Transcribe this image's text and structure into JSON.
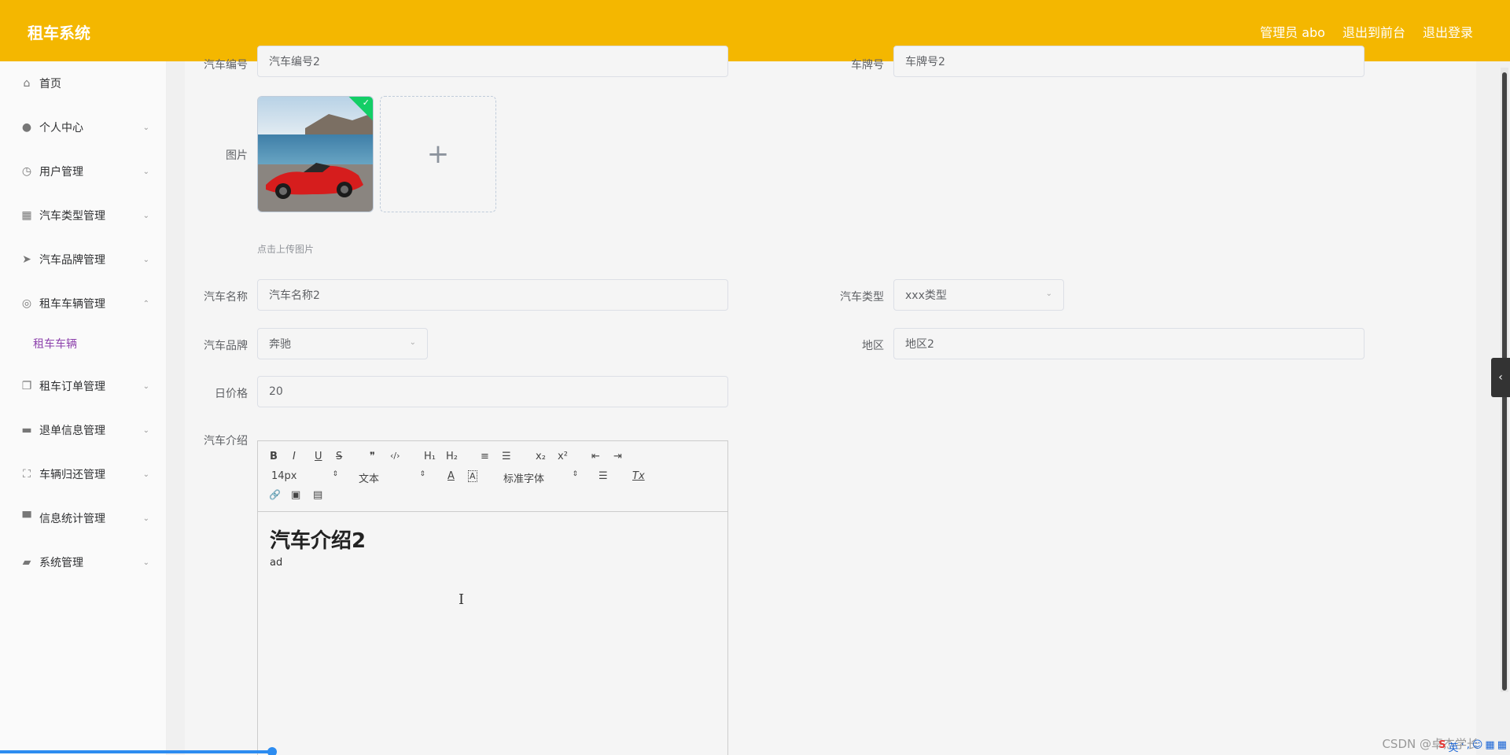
{
  "header": {
    "brand": "租车系统",
    "admin_label": "管理员 abo",
    "to_frontend": "退出到前台",
    "logout": "退出登录"
  },
  "sidebar": {
    "items": [
      {
        "label": "首页",
        "icon": "home-icon"
      },
      {
        "label": "个人中心",
        "icon": "user-icon"
      },
      {
        "label": "用户管理",
        "icon": "clock-icon"
      },
      {
        "label": "汽车类型管理",
        "icon": "grid-icon"
      },
      {
        "label": "汽车品牌管理",
        "icon": "send-icon"
      },
      {
        "label": "租车车辆管理",
        "icon": "target-icon"
      },
      {
        "label": "租车订单管理",
        "icon": "copy-icon"
      },
      {
        "label": "退单信息管理",
        "icon": "ticket-icon"
      },
      {
        "label": "车辆归还管理",
        "icon": "fullscreen-icon"
      },
      {
        "label": "信息统计管理",
        "icon": "printer-icon"
      },
      {
        "label": "系统管理",
        "icon": "briefcase-icon"
      }
    ],
    "sub_item": "租车车辆"
  },
  "form": {
    "car_no_label": "汽车编号",
    "car_no_value": "汽车编号2",
    "plate_label": "车牌号",
    "plate_value": "车牌号2",
    "image_label": "图片",
    "upload_tip": "点击上传图片",
    "add_symbol": "+",
    "name_label": "汽车名称",
    "name_value": "汽车名称2",
    "type_label": "汽车类型",
    "type_value": "xxx类型",
    "brand_label": "汽车品牌",
    "brand_value": "奔驰",
    "region_label": "地区",
    "region_value": "地区2",
    "price_label": "日价格",
    "price_value": "20",
    "intro_label": "汽车介绍"
  },
  "editor": {
    "toolbar": {
      "bold": "B",
      "italic": "I",
      "underline": "U",
      "strike": "S",
      "quote": "❞",
      "code": "‹/›",
      "h1": "H₁",
      "h2": "H₂",
      "ol": "≡",
      "ul": "☰",
      "sub": "x₂",
      "sup": "x²",
      "outdent": "⇤",
      "indent": "⇥",
      "size": "14px",
      "text_type": "文本",
      "color": "A",
      "bg": "A",
      "font": "标准字体",
      "align": "☰",
      "clear": "Tx",
      "link": "🔗",
      "image": "▣",
      "video": "▤"
    },
    "heading": "汽车介绍2",
    "paragraph": "ad"
  },
  "watermark": "CSDN @卓杰学长",
  "ime": [
    "S",
    "英",
    "·",
    ",",
    "☺",
    "▦",
    "▦"
  ]
}
